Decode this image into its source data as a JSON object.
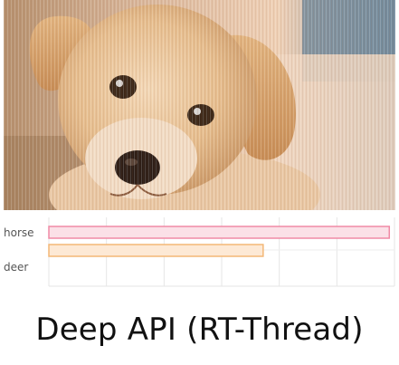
{
  "caption": "Deep API (RT-Thread)",
  "photo": {
    "subject": "puppy"
  },
  "chart_data": {
    "type": "bar",
    "orientation": "horizontal",
    "categories": [
      "horse",
      "deer"
    ],
    "series": [
      {
        "values": [
          0.985,
          0.62
        ],
        "colors": [
          "#f4a7b9",
          "#f6c48e"
        ]
      }
    ],
    "xlim": [
      0,
      1
    ],
    "grid": true,
    "colors": {
      "bar_pink_fill": "#fbe0e7",
      "bar_pink_stroke": "#f08aa5",
      "bar_orange_fill": "#fde9d5",
      "bar_orange_stroke": "#f3b777"
    }
  }
}
